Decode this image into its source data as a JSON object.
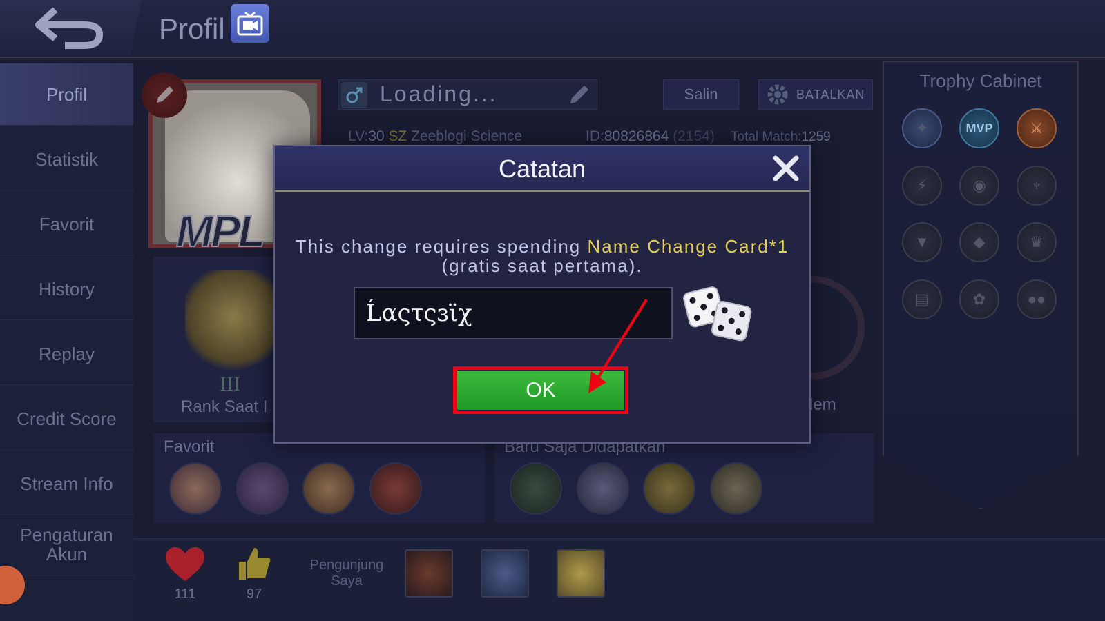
{
  "header": {
    "title": "Profil",
    "back_icon": "back-arrow-icon",
    "stream_icon": "tv-stream-icon"
  },
  "sidebar": {
    "items": [
      {
        "label": "Profil",
        "active": true
      },
      {
        "label": "Statistik"
      },
      {
        "label": "Favorit"
      },
      {
        "label": "History"
      },
      {
        "label": "Replay"
      },
      {
        "label": "Credit Score"
      },
      {
        "label": "Stream Info"
      },
      {
        "label": "Pengaturan Akun"
      }
    ]
  },
  "profile": {
    "name": "Loading...",
    "copy_label": "Salin",
    "cancel_label": "BATALKAN",
    "level_label": "LV:",
    "level": "30",
    "squad_tag": "SZ",
    "squad_name": "Zeeblogi Science",
    "id_label": "ID:",
    "id": "80826864",
    "server": "(2154)",
    "total_match_label": "Total Match:",
    "total_match": "1259",
    "banner": "MPL",
    "rank_tier": "III",
    "rank_label": "Rank Saat I",
    "emblem_label": "lem"
  },
  "favorites": {
    "title": "Favorit"
  },
  "recent": {
    "title": "Baru Saja Didapatkan"
  },
  "trophy_cabinet": {
    "title": "Trophy Cabinet",
    "mvp_label": "MVP"
  },
  "bottom": {
    "likes": "111",
    "thumbs": "97",
    "visitors_label": "Pengunjung Saya"
  },
  "modal": {
    "title": "Catatan",
    "message_pre": "This change requires spending ",
    "message_highlight": "Name Change Card*1",
    "message_post": " (gratis saat pertama).",
    "input_value": "Ĺαςτςɜϊχ",
    "ok_label": "OK"
  },
  "colors": {
    "highlight_yellow": "#e3cf55",
    "ok_green": "#2aa830",
    "annotation_red": "#f00010"
  }
}
